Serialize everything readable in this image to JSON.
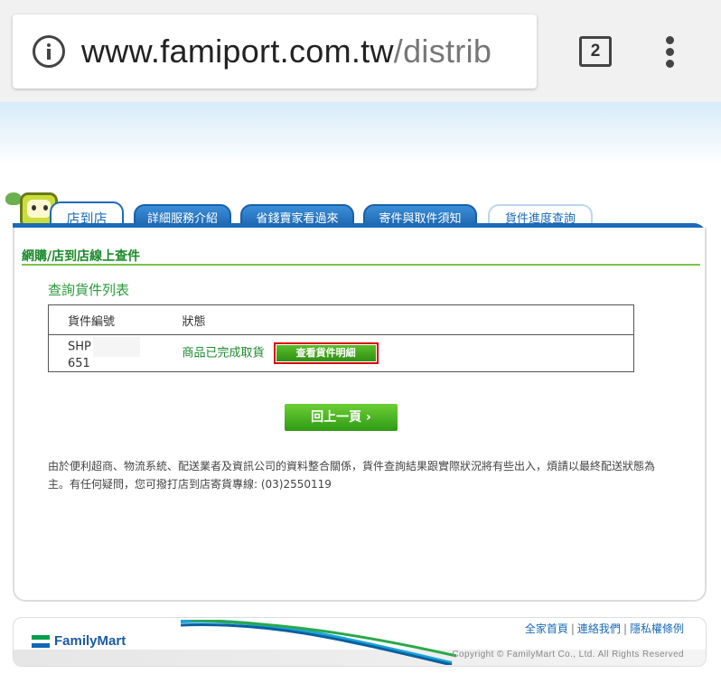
{
  "browser": {
    "url_host": "www.famiport.com.tw",
    "url_path": "/distrib",
    "tab_count": "2"
  },
  "tabs": [
    {
      "label": "店到店"
    },
    {
      "label": "詳細服務介紹"
    },
    {
      "label": "省錢賣家看過來"
    },
    {
      "label": "寄件與取件須知"
    },
    {
      "label": "貨件進度查詢"
    }
  ],
  "section": {
    "title": "網購/店到店線上查件",
    "subtitle": "查詢貨件列表"
  },
  "table": {
    "headers": [
      "貨件編號",
      "狀態"
    ],
    "rows": [
      {
        "id_prefix": "SHP",
        "id_suffix": "651",
        "status": "商品已完成取貨",
        "action": "查看貨件明細"
      }
    ]
  },
  "back_button": "回上一頁 ›",
  "notice": "由於便利超商、物流系統、配送業者及資訊公司的資料整合關係，貨件查詢結果跟實際狀況將有些出入，煩請以最終配送狀態為主。有任何疑問，您可撥打店到店寄貨專線: (03)2550119",
  "footer": {
    "brand": "FamilyMart",
    "links": [
      "全家首頁",
      "連絡我們",
      "隱私權條例"
    ],
    "copyright": "Copyright © FamilyMart Co., Ltd. All Rights Reserved"
  },
  "colors": {
    "tab_blue": "#1a5fa8",
    "green_text": "#1e8a2e",
    "button_green": "#3da61e",
    "highlight_red": "#d8000c"
  }
}
